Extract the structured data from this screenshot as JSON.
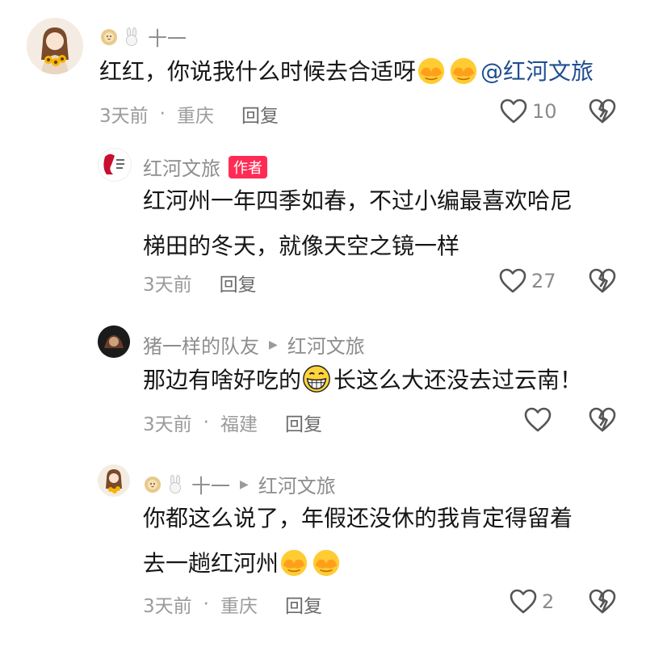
{
  "comments": [
    {
      "username": "十一",
      "text": "红红，你说我什么时候去合适呀",
      "mention": "@红河文旅",
      "time": "3天前",
      "location": "重庆",
      "reply_label": "回复",
      "likes": "10"
    },
    {
      "username": "红河文旅",
      "author_tag": "作者",
      "text_line1": "红河州一年四季如春，不过小编最喜欢哈尼",
      "text_line2": "梯田的冬天，就像天空之镜一样",
      "time": "3天前",
      "reply_label": "回复",
      "likes": "27"
    },
    {
      "username": "猪一样的队友",
      "reply_to": "红河文旅",
      "text_before": "那边有啥好吃的",
      "text_after": "长这么大还没去过云南！",
      "time": "3天前",
      "location": "福建",
      "reply_label": "回复"
    },
    {
      "username": "十一",
      "reply_to": "红河文旅",
      "text_line1": "你都这么说了，年假还没休的我肯定得留着",
      "text_line2": "去一趟红河州",
      "time": "3天前",
      "location": "重庆",
      "reply_label": "回复",
      "likes": "2"
    }
  ],
  "colors": {
    "accent": "#fe2c55",
    "mention": "#1f4e8f",
    "meta": "#9b9b9b"
  }
}
